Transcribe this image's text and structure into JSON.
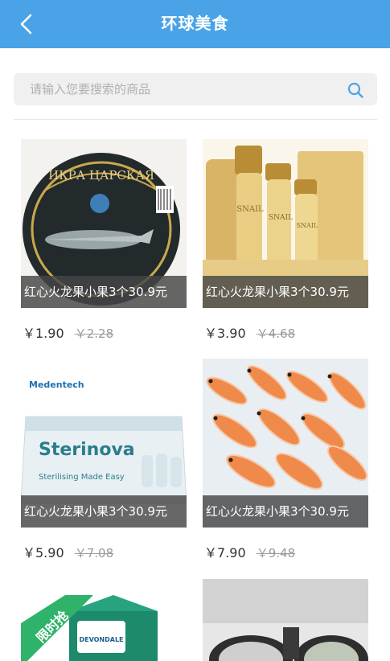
{
  "header": {
    "title": "环球美食"
  },
  "search": {
    "placeholder": "请输入您要搜索的商品"
  },
  "products": [
    {
      "caption": "红心火龙果小果3个30.9元",
      "price": "￥1.90",
      "old_price": "￥2.28",
      "brand": "ИКРА ЦАРСКАЯ"
    },
    {
      "caption": "红心火龙果小果3个30.9元",
      "price": "￥3.90",
      "old_price": "￥4.68",
      "brand": "SNAIL"
    },
    {
      "caption": "红心火龙果小果3个30.9元",
      "price": "￥5.90",
      "old_price": "￥7.08",
      "brand": "Sterinova",
      "maker": "Medentech",
      "tagline": "Sterilising Made Easy"
    },
    {
      "caption": "红心火龙果小果3个30.9元",
      "price": "￥7.90",
      "old_price": "￥9.48"
    },
    {
      "badge": "限时抢",
      "brand": "DEVONDALE"
    },
    {}
  ],
  "colors": {
    "header": "#4aa3e6",
    "search_bg": "#f0f0f0",
    "caption_bg": "rgba(70,70,70,0.82)",
    "icon": "#4aa3e6"
  }
}
